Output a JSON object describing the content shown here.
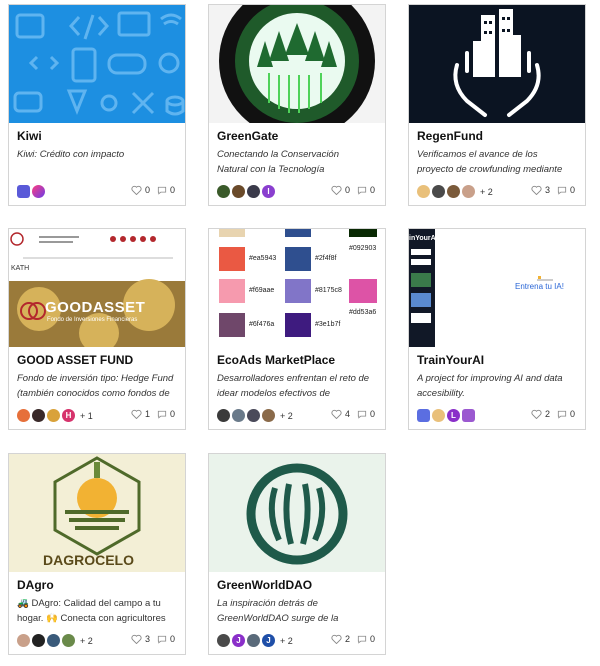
{
  "cards": [
    {
      "title": "Kiwi",
      "desc_line1": "Kiwi: Crédito con impacto",
      "desc_line2": "",
      "likes": "0",
      "comments": "0",
      "more": ""
    },
    {
      "title": "GreenGate",
      "desc_line1": "Conectando la Conservación",
      "desc_line2": "Natural con la Tecnología",
      "likes": "0",
      "comments": "0",
      "more": "",
      "avatar_letter": "I"
    },
    {
      "title": "RegenFund",
      "desc_line1": "Verificamos el avance de los",
      "desc_line2": "proyecto de crowfunding mediante",
      "likes": "3",
      "comments": "0",
      "more": "+ 2"
    },
    {
      "title": "GOOD ASSET FUND",
      "desc_line1": "Fondo de inversión tipo: Hedge Fund",
      "desc_line2": "(también conocidos como fondos de",
      "likes": "1",
      "comments": "0",
      "more": "+ 1",
      "avatar_letter": "H"
    },
    {
      "title": "EcoAds MarketPlace",
      "desc_line1": "Desarrolladores enfrentan el reto de",
      "desc_line2": "idear modelos efectivos de",
      "likes": "4",
      "comments": "0",
      "more": "+ 2"
    },
    {
      "title": "TrainYourAI",
      "desc_line1": "A project for improving AI and data",
      "desc_line2": "accesibility.",
      "likes": "2",
      "comments": "0",
      "more": "",
      "avatar_letter": "L"
    },
    {
      "title": "DAgro",
      "desc_line1": "🚜 DAgro: Calidad del campo a tu",
      "desc_line2": "hogar. 🙌 Conecta con agricultores",
      "likes": "3",
      "comments": "0",
      "more": "+ 2"
    },
    {
      "title": "GreenWorldDAO",
      "desc_line1": "La inspiración detrás de",
      "desc_line2": "GreenWorldDAO surge de la",
      "likes": "2",
      "comments": "0",
      "more": "+ 2",
      "avatar_letter": "J",
      "avatar_letter2": "J"
    }
  ],
  "thumbs": {
    "goodasset_brand": "GOODASSET",
    "goodasset_sub": "Fondo de Inversiones Financieras",
    "goodasset_kath": "KATH",
    "palette": [
      "#ea5943",
      "#2f4f8f",
      "#092903",
      "#f69aae",
      "#8175c8",
      "#dd53a6",
      "#6f476a",
      "#3e1b7f"
    ],
    "trainai_label": "Entrena tu IA!",
    "trainai_corner": "inYourAI",
    "dagro_brand": "DAGROCELO"
  }
}
